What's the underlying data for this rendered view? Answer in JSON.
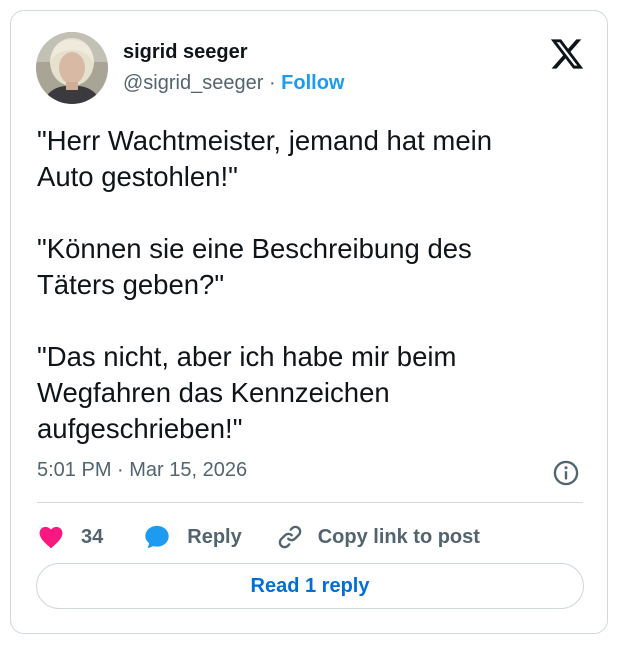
{
  "user": {
    "name": "sigrid seeger",
    "handle": "@sigrid_seeger",
    "separator": "·",
    "follow_label": "Follow"
  },
  "tweet": {
    "text": "\"Herr Wachtmeister, jemand hat mein\nAuto gestohlen!\"\n\n\"Können sie eine Beschreibung des\nTäters geben?\"\n\n\"Das nicht, aber ich habe mir beim\nWegfahren das Kennzeichen\naufgeschrieben!\"",
    "timestamp": "5:01 PM · Mar 15, 2026"
  },
  "actions": {
    "like_count": "34",
    "reply_label": "Reply",
    "copy_link_label": "Copy link to post"
  },
  "footer": {
    "read_replies_label": "Read 1 reply"
  },
  "icons": {
    "logo": "x-logo-icon",
    "info": "info-icon",
    "like": "heart-icon",
    "reply": "speech-bubble-icon",
    "copy_link": "link-icon"
  },
  "colors": {
    "accent": "#1d9bf0",
    "link_button_text": "#006fd6",
    "like": "#f91880",
    "secondary_text": "#536471",
    "border": "#cfd9de"
  }
}
